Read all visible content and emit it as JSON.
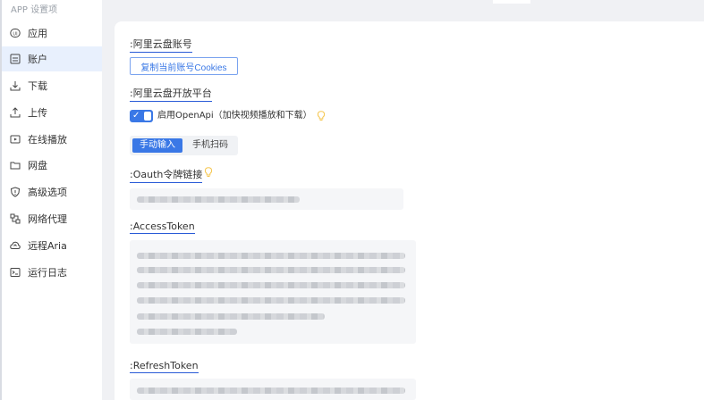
{
  "sidebar": {
    "title": "APP 设置项",
    "items": [
      {
        "label": "应用",
        "icon": "ui-icon"
      },
      {
        "label": "账户",
        "icon": "account-icon",
        "active": true
      },
      {
        "label": "下载",
        "icon": "download-icon"
      },
      {
        "label": "上传",
        "icon": "upload-icon"
      },
      {
        "label": "在线播放",
        "icon": "play-icon"
      },
      {
        "label": "网盘",
        "icon": "folder-icon"
      },
      {
        "label": "高级选项",
        "icon": "shield-icon"
      },
      {
        "label": "网络代理",
        "icon": "proxy-icon"
      },
      {
        "label": "远程Aria",
        "icon": "cloud-icon"
      },
      {
        "label": "运行日志",
        "icon": "terminal-icon"
      }
    ]
  },
  "main": {
    "aliyun_account": {
      "title": ":阿里云盘账号",
      "copy_cookies_label": "复制当前账号Cookies"
    },
    "open_platform": {
      "title": ":阿里云盘开放平台",
      "toggle_label": "启用OpenApi（加快视频播放和下载）",
      "toggle_on": true,
      "input_mode_tabs": [
        {
          "label": "手动输入",
          "selected": true
        },
        {
          "label": "手机扫码",
          "selected": false
        }
      ]
    },
    "oauth": {
      "title": ":Oauth令牌链接"
    },
    "access_token": {
      "title": ":AccessToken"
    },
    "refresh_token": {
      "title": ":RefreshToken"
    }
  },
  "colors": {
    "accent": "#3a78e6",
    "underline": "#2a5bd7",
    "hint_bulb": "#f5c64f",
    "active_bg": "#e8f0fd"
  }
}
